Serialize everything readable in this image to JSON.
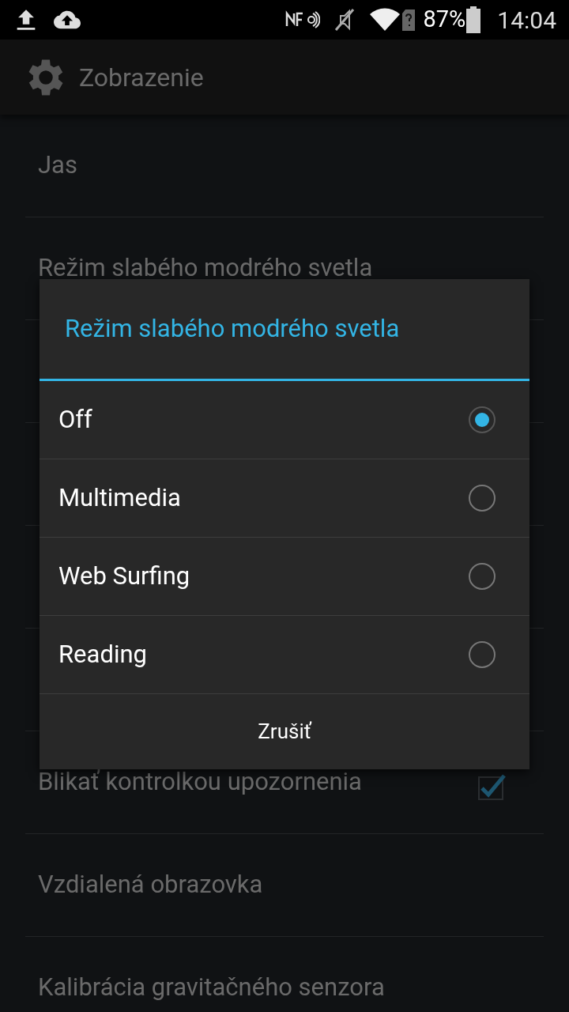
{
  "status_bar": {
    "battery": "87%",
    "time": "14:04"
  },
  "action_bar": {
    "title": "Zobrazenie"
  },
  "settings": [
    {
      "label": "Jas",
      "kind": "plain"
    },
    {
      "label": "Režim slabého modrého svetla",
      "kind": "plain"
    },
    {
      "label": "Blikať kontrolkou upozornenia",
      "kind": "checkbox",
      "checked": true
    },
    {
      "label": "Vzdialená obrazovka",
      "kind": "plain"
    },
    {
      "label": "Kalibrácia gravitačného senzora",
      "kind": "plain"
    }
  ],
  "dialog": {
    "title": "Režim slabého modrého svetla",
    "options": [
      {
        "label": "Off",
        "selected": true
      },
      {
        "label": "Multimedia",
        "selected": false
      },
      {
        "label": "Web Surfing",
        "selected": false
      },
      {
        "label": "Reading",
        "selected": false
      }
    ],
    "cancel": "Zrušiť"
  }
}
